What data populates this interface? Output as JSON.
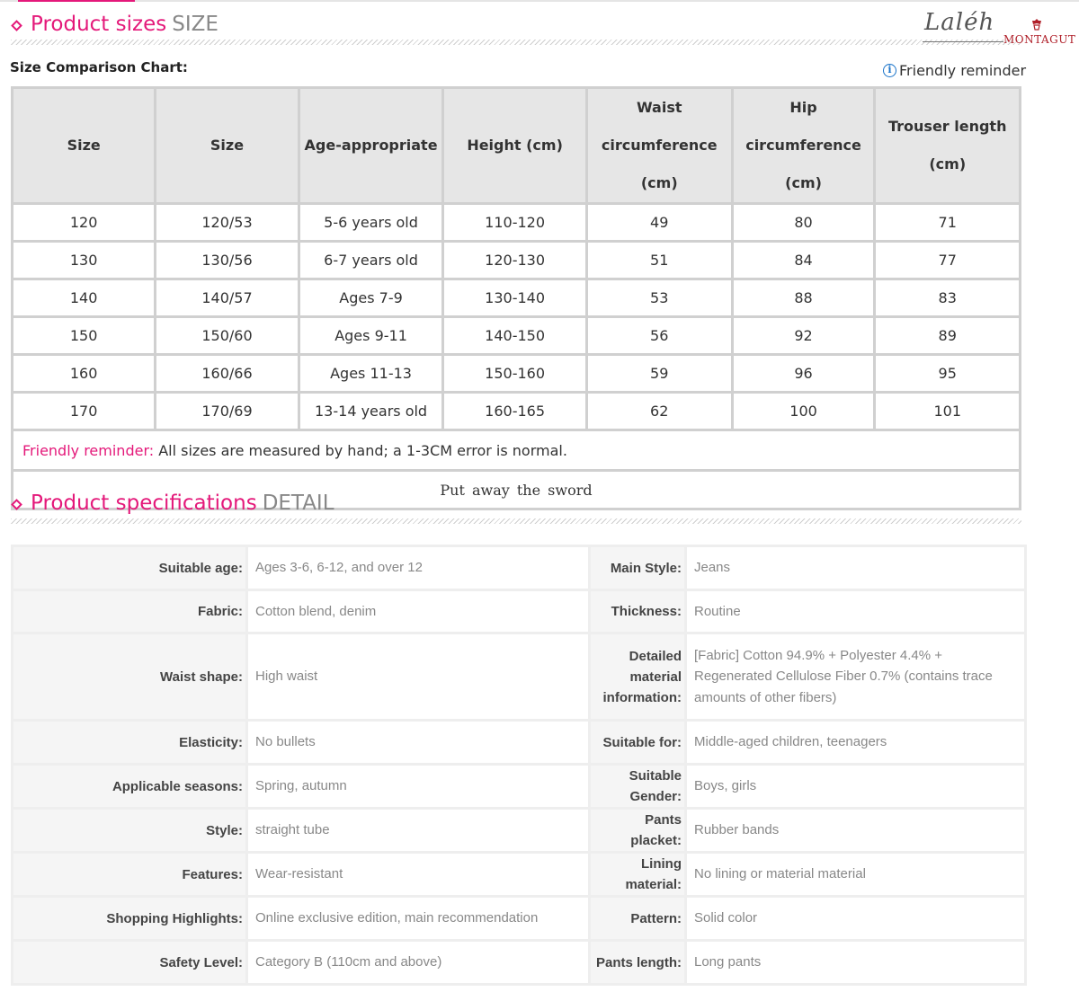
{
  "sizes_section": {
    "title": "Product sizes",
    "title_en": "SIZE"
  },
  "brand": {
    "script": "Laléh",
    "name": "MONTAGUT"
  },
  "chart_label": "Size Comparison Chart:",
  "reminder_link": "Friendly reminder",
  "size_table": {
    "headers": [
      "Size",
      "Size",
      "Age-appropriate",
      "Height (cm)",
      "Waist circumference (cm)",
      "Hip circumference (cm)",
      "Trouser length (cm)"
    ],
    "rows": [
      [
        "120",
        "120/53",
        "5-6 years old",
        "110-120",
        "49",
        "80",
        "71"
      ],
      [
        "130",
        "130/56",
        "6-7 years old",
        "120-130",
        "51",
        "84",
        "77"
      ],
      [
        "140",
        "140/57",
        "Ages 7-9",
        "130-140",
        "53",
        "88",
        "83"
      ],
      [
        "150",
        "150/60",
        "Ages 9-11",
        "140-150",
        "56",
        "92",
        "89"
      ],
      [
        "160",
        "160/66",
        "Ages 11-13",
        "150-160",
        "59",
        "96",
        "95"
      ],
      [
        "170",
        "170/69",
        "13-14 years old",
        "160-165",
        "62",
        "100",
        "101"
      ]
    ],
    "note_label": "Friendly reminder:",
    "note_text": " All sizes are measured by hand; a 1-3CM error is normal.",
    "footer": "Put away the sword"
  },
  "specs_section": {
    "title": "Product specifications",
    "title_en": "DETAIL"
  },
  "specs": [
    {
      "k1": "Suitable age:",
      "v1": "Ages 3-6, 6-12, and over 12",
      "k2": "Main Style:",
      "v2": "Jeans"
    },
    {
      "k1": "Fabric:",
      "v1": "Cotton blend, denim",
      "k2": "Thickness:",
      "v2": "Routine"
    },
    {
      "k1": "Waist shape:",
      "v1": "High waist",
      "k2": "Detailed material information:",
      "v2": "[Fabric] Cotton 94.9% + Polyester 4.4% + Regenerated Cellulose Fiber 0.7% (contains trace amounts of other fibers)"
    },
    {
      "k1": "Elasticity:",
      "v1": "No bullets",
      "k2": "Suitable for:",
      "v2": "Middle-aged children, teenagers"
    },
    {
      "k1": "Applicable seasons:",
      "v1": "Spring, autumn",
      "k2": "Suitable Gender:",
      "v2": "Boys, girls"
    },
    {
      "k1": "Style:",
      "v1": "straight tube",
      "k2": "Pants placket:",
      "v2": "Rubber bands"
    },
    {
      "k1": "Features:",
      "v1": "Wear-resistant",
      "k2": "Lining material:",
      "v2": "No lining or material material"
    },
    {
      "k1": "Shopping Highlights:",
      "v1": "Online exclusive edition, main recommendation",
      "k2": "Pattern:",
      "v2": "Solid color"
    },
    {
      "k1": "Safety Level:",
      "v1": "Category B (110cm and above)",
      "k2": "Pants length:",
      "v2": "Long pants"
    }
  ]
}
